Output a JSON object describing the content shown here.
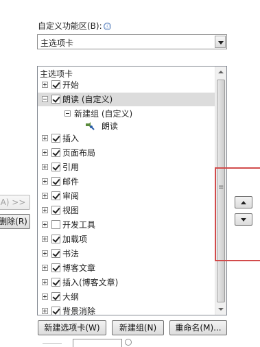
{
  "customize_ribbon": {
    "label": "自定义功能区(B):",
    "info_icon": "ⓘ",
    "selected": "主选项卡"
  },
  "tree": {
    "header": "主选项卡",
    "items": [
      {
        "label": "开始",
        "checked": true,
        "expanded": false
      },
      {
        "label": "朗读 (自定义)",
        "checked": true,
        "expanded": true
      },
      {
        "label": "新建组 (自定义)"
      },
      {
        "label": "朗读"
      },
      {
        "label": "插入",
        "checked": true,
        "expanded": false
      },
      {
        "label": "页面布局",
        "checked": true,
        "expanded": false
      },
      {
        "label": "引用",
        "checked": true,
        "expanded": false
      },
      {
        "label": "邮件",
        "checked": true,
        "expanded": false
      },
      {
        "label": "审阅",
        "checked": true,
        "expanded": false
      },
      {
        "label": "视图",
        "checked": true,
        "expanded": false
      },
      {
        "label": "开发工具",
        "checked": false,
        "expanded": false
      },
      {
        "label": "加载项",
        "checked": true,
        "expanded": false
      },
      {
        "label": "书法",
        "checked": true,
        "expanded": false
      },
      {
        "label": "博客文章",
        "checked": true,
        "expanded": false
      },
      {
        "label": "插入(博客文章)",
        "checked": true,
        "expanded": false
      },
      {
        "label": "大纲",
        "checked": true,
        "expanded": false
      },
      {
        "label": "背景消除",
        "checked": true,
        "expanded": false
      }
    ]
  },
  "buttons": {
    "add": "A) >>",
    "remove": "删除(R)",
    "new_tab": "新建选项卡(W)",
    "new_group": "新建组(N)",
    "rename": "重命名(M)..."
  },
  "colors": {
    "highlight": "#d24b4b",
    "selected_row": "#dcdcdc"
  },
  "icons": {
    "command": "speaker-command-icon",
    "move_up": "triangle-up-icon",
    "move_down": "triangle-down-icon"
  }
}
